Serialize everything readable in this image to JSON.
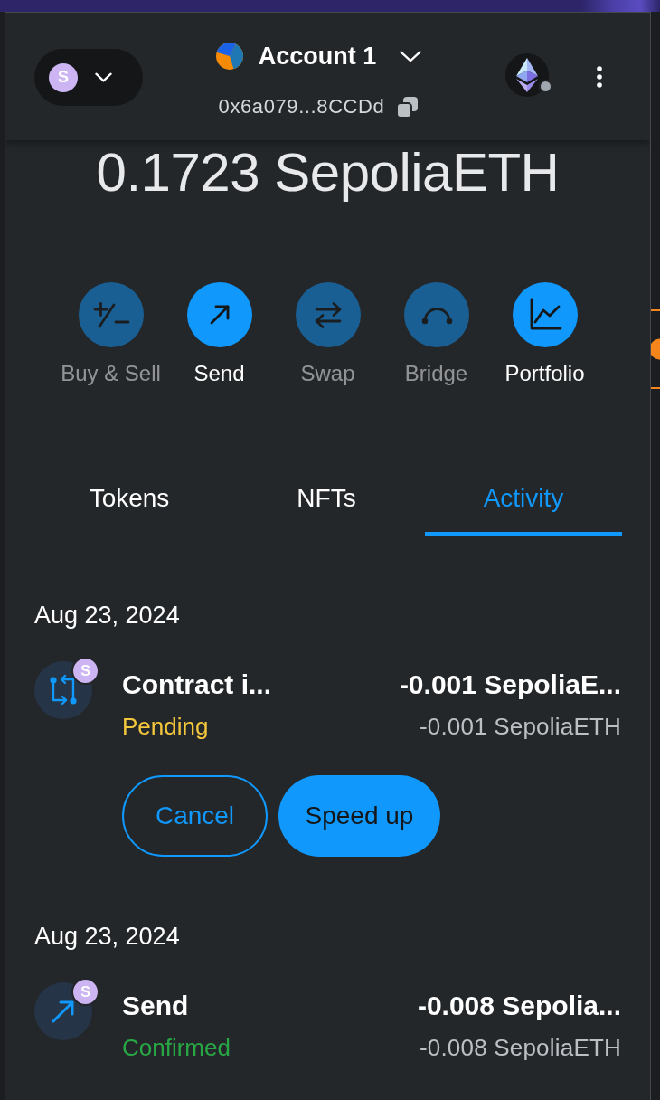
{
  "header": {
    "network": {
      "badge": "S"
    },
    "account": {
      "name": "Account 1",
      "address": "0x6a079...8CCDd"
    }
  },
  "balance": "0.1723 SepoliaETH",
  "actions": [
    {
      "kind": "buy",
      "label": "Buy & Sell",
      "disabled": true
    },
    {
      "kind": "send",
      "label": "Send",
      "disabled": false
    },
    {
      "kind": "swap",
      "label": "Swap",
      "disabled": true
    },
    {
      "kind": "bridge",
      "label": "Bridge",
      "disabled": true
    },
    {
      "kind": "portfolio",
      "label": "Portfolio",
      "disabled": false
    }
  ],
  "tabs": [
    {
      "label": "Tokens",
      "selected": false
    },
    {
      "label": "NFTs",
      "selected": false
    },
    {
      "label": "Activity",
      "selected": true
    }
  ],
  "activity": [
    {
      "date": "Aug 23, 2024",
      "transactions": [
        {
          "kind": "contract",
          "badge": "S",
          "title": "Contract i...",
          "amount": "-0.001 SepoliaE...",
          "status": {
            "text": "Pending",
            "color": "#f5c73d"
          },
          "secondary_amount": "-0.001 SepoliaETH",
          "buttons": [
            {
              "kind": "cancel",
              "label": "Cancel"
            },
            {
              "kind": "speedup",
              "label": "Speed up"
            }
          ]
        }
      ]
    },
    {
      "date": "Aug 23, 2024",
      "transactions": [
        {
          "kind": "send",
          "badge": "S",
          "title": "Send",
          "amount": "-0.008 Sepolia...",
          "status": {
            "text": "Confirmed",
            "color": "#28a745"
          },
          "secondary_amount": "-0.008 SepoliaETH"
        }
      ]
    }
  ]
}
